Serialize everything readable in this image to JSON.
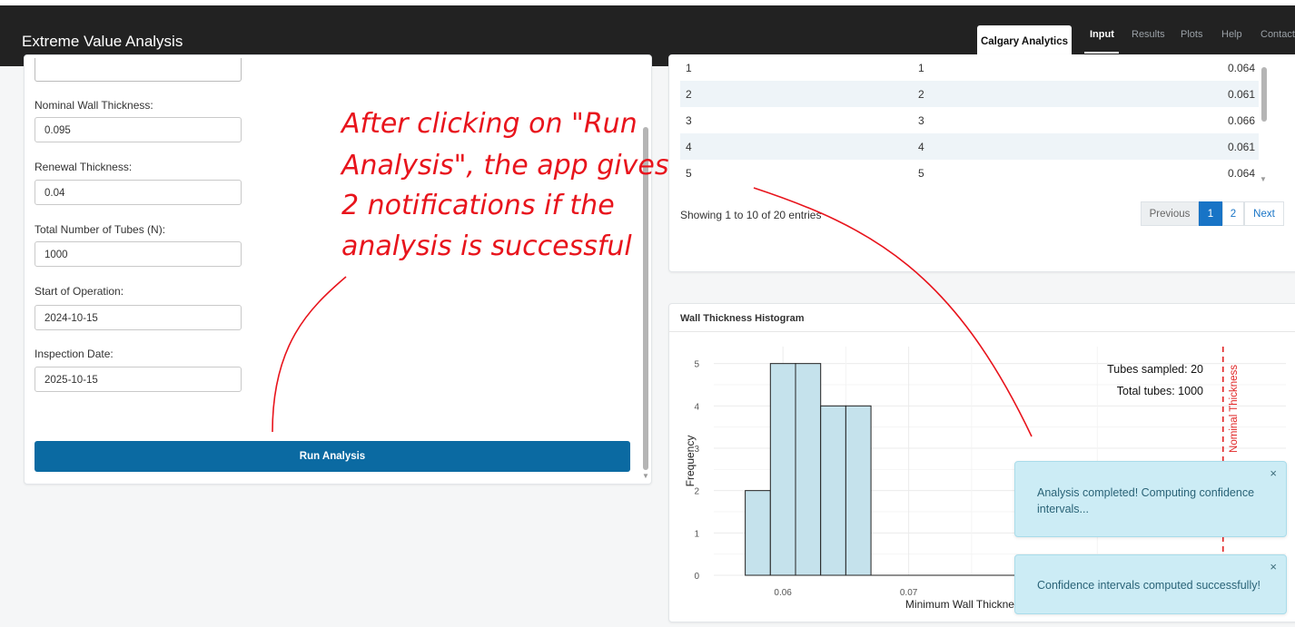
{
  "navbar": {
    "title": "Extreme Value Analysis",
    "company": "Calgary Analytics",
    "tabs": [
      {
        "label": "Input",
        "active": true
      },
      {
        "label": "Results",
        "active": false
      },
      {
        "label": "Plots",
        "active": false
      },
      {
        "label": "Help",
        "active": false
      },
      {
        "label": "Contact",
        "active": false
      }
    ]
  },
  "form": {
    "fields": [
      {
        "label": "Nominal Wall Thickness:",
        "value": "0.095"
      },
      {
        "label": "Renewal Thickness:",
        "value": "0.04"
      },
      {
        "label": "Total Number of Tubes (N):",
        "value": "1000"
      },
      {
        "label": "Start of Operation:",
        "value": "2024-10-15"
      },
      {
        "label": "Inspection Date:",
        "value": "2025-10-15"
      }
    ],
    "run_button": "Run Analysis"
  },
  "table": {
    "rows": [
      [
        "1",
        "1",
        "0.064"
      ],
      [
        "2",
        "2",
        "0.061"
      ],
      [
        "3",
        "3",
        "0.066"
      ],
      [
        "4",
        "4",
        "0.061"
      ],
      [
        "5",
        "5",
        "0.064"
      ]
    ],
    "info": "Showing 1 to 10 of 20 entries",
    "pagination": {
      "previous": "Previous",
      "pages": [
        "1",
        "2"
      ],
      "next": "Next"
    }
  },
  "histogram": {
    "title": "Wall Thickness Histogram"
  },
  "chart_data": {
    "type": "bar",
    "xlabel": "Minimum Wall Thickness",
    "ylabel": "Frequency",
    "bins": [
      {
        "start": 0.057,
        "end": 0.059,
        "count": 2
      },
      {
        "start": 0.059,
        "end": 0.061,
        "count": 5
      },
      {
        "start": 0.061,
        "end": 0.063,
        "count": 5
      },
      {
        "start": 0.063,
        "end": 0.065,
        "count": 4
      },
      {
        "start": 0.065,
        "end": 0.067,
        "count": 4
      }
    ],
    "x_ticks": [
      "0.06",
      "0.07"
    ],
    "y_ticks": [
      "0",
      "1",
      "2",
      "3",
      "4",
      "5"
    ],
    "xlim": [
      0.0545,
      0.1
    ],
    "ylim": [
      0,
      5.4
    ],
    "grid": true,
    "annotations": [
      "Tubes sampled: 20",
      "Total tubes: 1000"
    ],
    "reference_line": {
      "label": "Nominal Thickness",
      "x": 0.095,
      "color": "#e02424",
      "style": "dashed"
    },
    "bar_fill": "#c5e2ec"
  },
  "notifications": [
    {
      "message": "Analysis completed! Computing confidence intervals...",
      "close": "×"
    },
    {
      "message": "Confidence intervals computed successfully!",
      "close": "×"
    }
  ],
  "callout": {
    "lines": [
      "After clicking on \"Run",
      "Analysis\", the app gives",
      "2 notifications if the",
      "analysis is successful"
    ],
    "color": "#e8141c"
  }
}
